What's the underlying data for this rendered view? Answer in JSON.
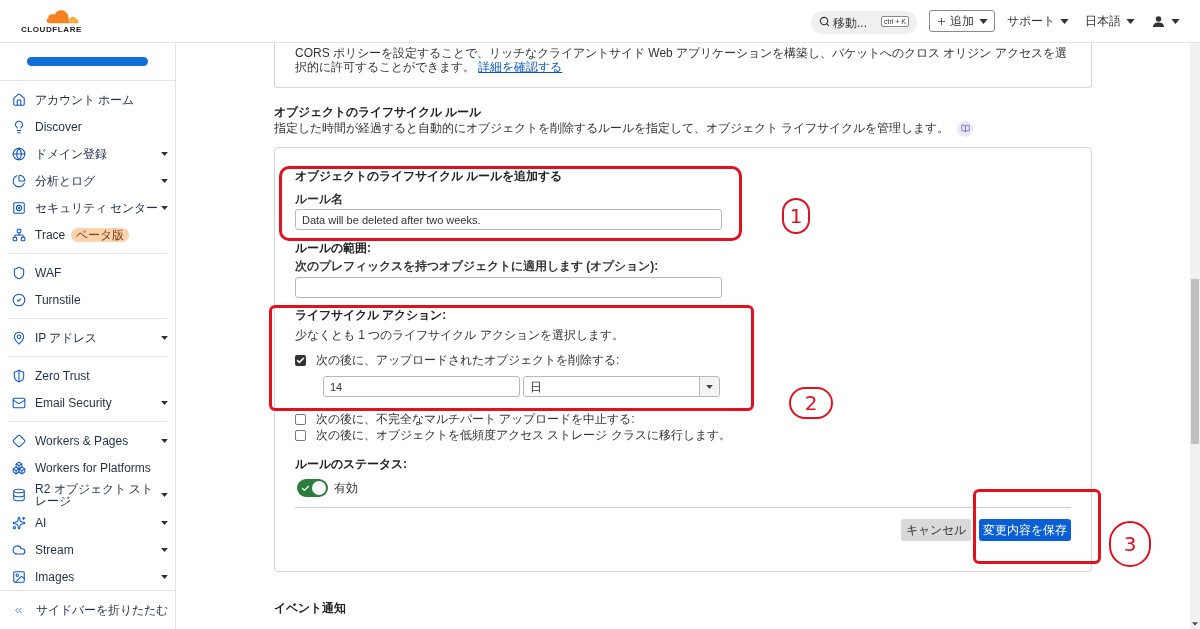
{
  "header": {
    "logo_text": "CLOUDFLARE",
    "search": {
      "placeholder": "移動...",
      "shortcut": "ctrl + K"
    },
    "add_button": "追加",
    "support_menu": "サポート",
    "language_menu": "日本語"
  },
  "sidebar": {
    "groups": [
      {
        "items": [
          {
            "label": "アカウント ホーム",
            "expandable": false
          },
          {
            "label": "Discover",
            "expandable": false
          },
          {
            "label": "ドメイン登録",
            "expandable": true
          },
          {
            "label": "分析とログ",
            "expandable": true
          },
          {
            "label": "セキュリティ センター",
            "expandable": true
          },
          {
            "label": "Trace",
            "expandable": false,
            "badge": "ベータ版"
          }
        ]
      },
      {
        "items": [
          {
            "label": "WAF",
            "expandable": false
          },
          {
            "label": "Turnstile",
            "expandable": false
          }
        ]
      },
      {
        "items": [
          {
            "label": "IP アドレス",
            "expandable": true
          }
        ]
      },
      {
        "items": [
          {
            "label": "Zero Trust",
            "expandable": false
          },
          {
            "label": "Email Security",
            "expandable": true
          }
        ]
      },
      {
        "items": [
          {
            "label": "Workers & Pages",
            "expandable": true
          },
          {
            "label": "Workers for Platforms",
            "expandable": false
          },
          {
            "label": "R2 オブジェクト ストレージ",
            "expandable": true
          },
          {
            "label": "AI",
            "expandable": true
          },
          {
            "label": "Stream",
            "expandable": true
          },
          {
            "label": "Images",
            "expandable": true
          }
        ]
      }
    ],
    "collapse_button": "サイドバーを折りたたむ"
  },
  "cors_card": {
    "text": "CORS ポリシーを設定することで、リッチなクライアントサイド Web アプリケーションを構築し、バケットへのクロス オリジン アクセスを選択的に許可することができます。",
    "link": "詳細を確認する"
  },
  "lifecycle_rules": {
    "title": "オブジェクトのライフサイクル ルール",
    "description": "指定した時間が経過すると自動的にオブジェクトを削除するルールを指定して、オブジェクト ライフサイクルを管理します。",
    "form": {
      "title": "オブジェクトのライフサイクル ルールを追加する",
      "rule_name": {
        "label": "ルール名",
        "value": "Data will be deleted after two weeks."
      },
      "scope": {
        "title": "ルールの範囲:",
        "label": "次のプレフィックスを持つオブジェクトに適用します (オプション):"
      },
      "actions": {
        "title": "ライフサイクル アクション:",
        "description": "少なくとも 1 つのライフサイクル アクションを選択します。",
        "options": [
          {
            "label": "次の後に、アップロードされたオブジェクトを削除する:",
            "checked": true,
            "amount": "14",
            "unit": "日"
          },
          {
            "label": "次の後に、不完全なマルチパート アップロードを中止する:",
            "checked": false
          },
          {
            "label": "次の後に、オブジェクトを低頻度アクセス ストレージ クラスに移行します。",
            "checked": false
          }
        ]
      },
      "status": {
        "title": "ルールのステータス:",
        "on": true,
        "label": "有効"
      },
      "cancel_button": "キャンセル",
      "save_button": "変更内容を保存"
    }
  },
  "event_notifications": {
    "title": "イベント通知"
  },
  "annotations": [
    {
      "label": "1"
    },
    {
      "label": "2"
    },
    {
      "label": "3"
    }
  ]
}
